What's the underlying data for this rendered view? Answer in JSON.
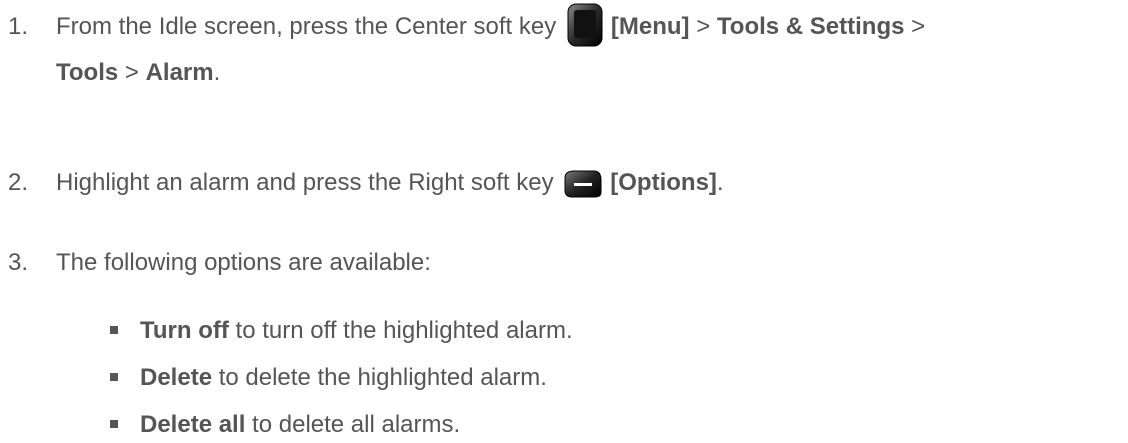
{
  "steps": [
    {
      "number": "1.",
      "text_a": "From the Idle screen, press the Center soft key",
      "key_label": "[Menu]",
      "sep1": " > ",
      "menu_1": "Tools & Settings",
      "sep2": " >",
      "menu_2": "Tools",
      "sep3": " > ",
      "menu_3": "Alarm",
      "end": "."
    },
    {
      "number": "2.",
      "text_a": "Highlight an alarm and press the Right soft key",
      "key_label": "[Options]",
      "end": "."
    },
    {
      "number": "3.",
      "text_a": "The following options are available:"
    }
  ],
  "options": [
    {
      "term": "Turn off",
      "description": " to turn off the highlighted alarm."
    },
    {
      "term": "Delete",
      "description": " to delete the highlighted alarm."
    },
    {
      "term": "Delete all",
      "description": " to delete all alarms."
    }
  ],
  "icons": {
    "center_key": "center-soft-key-icon",
    "right_key": "right-soft-key-icon"
  }
}
